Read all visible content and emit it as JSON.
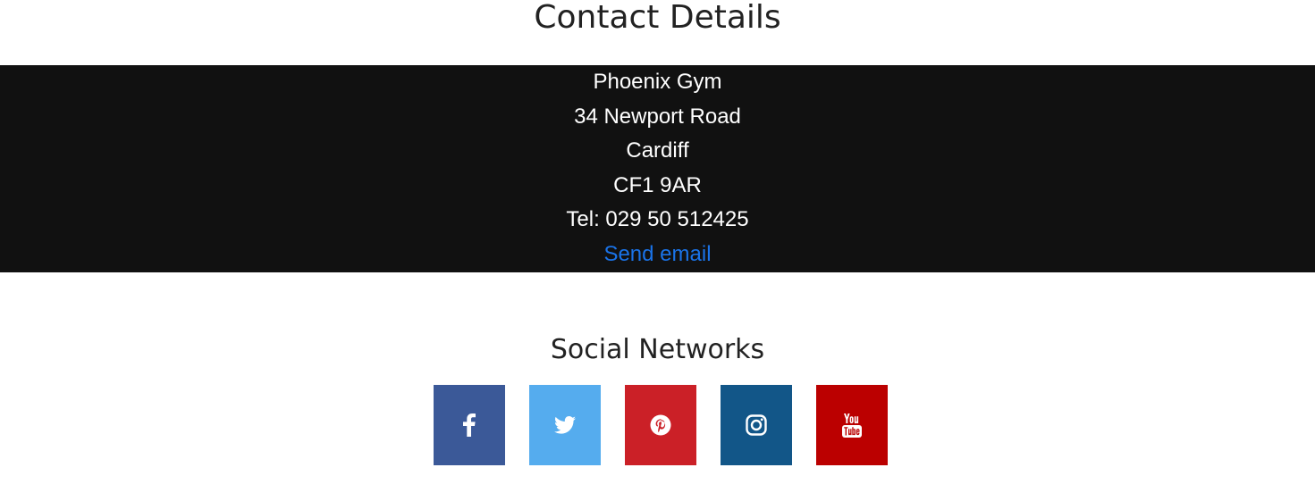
{
  "contact": {
    "title": "Contact Details",
    "lines": [
      "Phoenix Gym",
      "34 Newport Road",
      "Cardiff",
      "CF1 9AR",
      "Tel: 029 50 512425"
    ],
    "email_label": "Send email"
  },
  "social": {
    "title": "Social Networks",
    "networks": [
      {
        "name": "facebook",
        "icon": "facebook-icon",
        "color": "#3b5998"
      },
      {
        "name": "twitter",
        "icon": "twitter-icon",
        "color": "#55acee"
      },
      {
        "name": "pinterest",
        "icon": "pinterest-icon",
        "color": "#cb2027"
      },
      {
        "name": "instagram",
        "icon": "instagram-icon",
        "color": "#125688"
      },
      {
        "name": "youtube",
        "icon": "youtube-icon",
        "color": "#bb0000"
      }
    ]
  },
  "colors": {
    "contact_bg": "#111111",
    "link": "#1a73e8",
    "heading": "#222222"
  }
}
